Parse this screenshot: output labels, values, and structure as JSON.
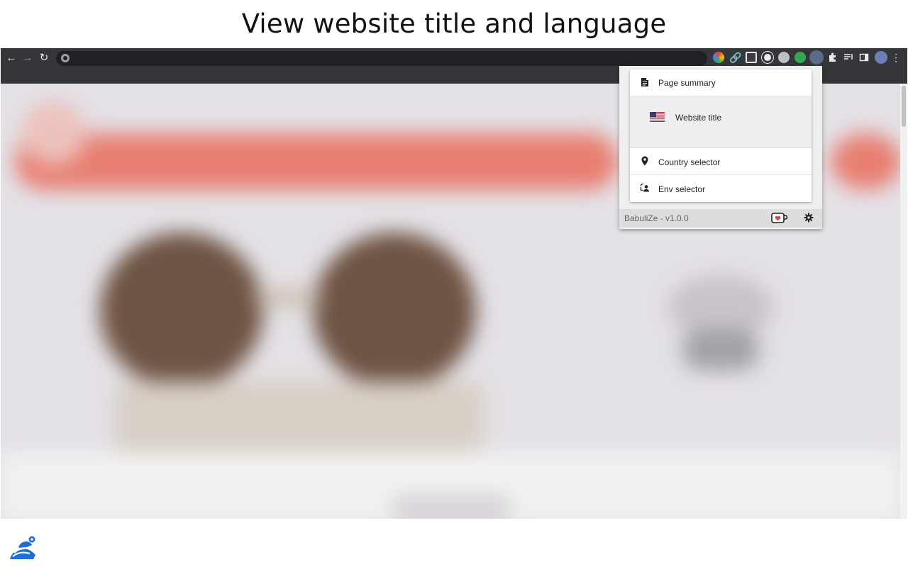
{
  "headline": "View website title and language",
  "popup": {
    "items": [
      {
        "label": "Page summary",
        "icon": "document-icon"
      },
      {
        "label": "Website title",
        "icon": "us-flag-icon"
      },
      {
        "label": "Country selector",
        "icon": "location-pin-icon"
      },
      {
        "label": "Env selector",
        "icon": "env-switch-icon"
      }
    ],
    "footer": {
      "version": "BabuliZe - v1.0.0",
      "support_icon": "coffee-heart-icon",
      "settings_icon": "gear-icon"
    }
  },
  "colors": {
    "toolbar": "#35363a",
    "omnibox": "#202124",
    "banner": "#e87f72",
    "logo": "#1f6fd6"
  }
}
